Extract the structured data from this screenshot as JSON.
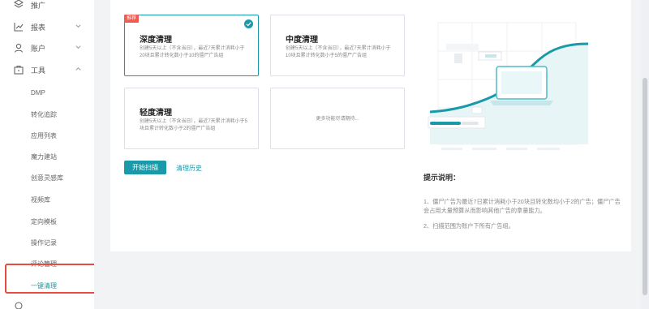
{
  "sidebar": {
    "groups": [
      {
        "label": "推广",
        "icon": "layers-icon"
      },
      {
        "label": "报表",
        "icon": "line-chart-icon"
      },
      {
        "label": "账户",
        "icon": "user-icon"
      },
      {
        "label": "工具",
        "icon": "toolbox-icon"
      }
    ],
    "tools_items": [
      "DMP",
      "转化追踪",
      "应用列表",
      "魔力建站",
      "创意灵感库",
      "视频库",
      "定向模板",
      "操作记录",
      "评论管理",
      "一键清理"
    ],
    "active_item": "一键清理"
  },
  "cards": [
    {
      "title": "深度清理",
      "desc": "创建5天以上（不含当日），最近7天累计消耗小于20块且累计转化数小于10的僵尸广告组",
      "tag": "推荐",
      "selected": true
    },
    {
      "title": "中度清理",
      "desc": "创建5天以上（不含当日），最近7天累计消耗小于10块且累计转化数小于5的僵尸广告组",
      "selected": false
    },
    {
      "title": "轻度清理",
      "desc": "创建5天以上（不含当日），最近7天累计消耗小于5块且累计转化数小于2的僵尸广告组",
      "selected": false
    },
    {
      "more": "更多功能尽请期待..."
    }
  ],
  "actions": {
    "scan": "开始扫描",
    "history": "清理历史"
  },
  "tips": {
    "title": "提示说明：",
    "items": [
      "1、僵尸广告为最近7日累计消耗小于20块且转化数均小于2的广告；僵尸广告会占用大量预算从而影响其他广告的拿量能力。",
      "2、扫描范围为账户下所有广告组。"
    ]
  },
  "colors": {
    "accent": "#1a9aa8",
    "tag": "#f05b4f",
    "highlight": "#e74c3c"
  }
}
